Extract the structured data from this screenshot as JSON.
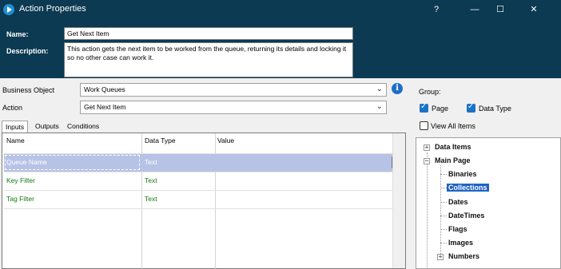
{
  "window": {
    "title": "Action Properties",
    "help_glyph": "?",
    "minimize_glyph": "—",
    "maximize_glyph": "☐",
    "close_glyph": "✕"
  },
  "header": {
    "name_label": "Name:",
    "name_value": "Get Next Item",
    "description_label": "Description:",
    "description_value": "This action gets the next item to be worked from the queue, returning its details and locking it so no other case can work it."
  },
  "form": {
    "business_object_label": "Business Object",
    "business_object_value": "Work Queues",
    "action_label": "Action",
    "action_value": "Get Next Item",
    "info_glyph": "i",
    "chevron_glyph": "⌄"
  },
  "tabs": [
    {
      "label": "Inputs",
      "active": true
    },
    {
      "label": "Outputs",
      "active": false
    },
    {
      "label": "Conditions",
      "active": false
    }
  ],
  "inputs_grid": {
    "columns": [
      "Name",
      "Data Type",
      "Value"
    ],
    "rows": [
      {
        "name": "Queue Name",
        "type": "Text",
        "value": "",
        "selected": true
      },
      {
        "name": "Key Filter",
        "type": "Text",
        "value": "",
        "selected": false
      },
      {
        "name": "Tag Filter",
        "type": "Text",
        "value": "",
        "selected": false
      }
    ]
  },
  "group": {
    "label": "Group:",
    "page_label": "Page",
    "page_checked": true,
    "data_type_label": "Data Type",
    "data_type_checked": true,
    "view_all_label": "View All Items",
    "view_all_checked": false
  },
  "tree": {
    "data_items_label": "Data Items",
    "main_page_label": "Main Page",
    "children": [
      "Binaries",
      "Collections",
      "Dates",
      "DateTimes",
      "Flags",
      "Images",
      "Numbers"
    ],
    "selected": "Collections",
    "expand_glyph": "+",
    "collapse_glyph": "−"
  }
}
